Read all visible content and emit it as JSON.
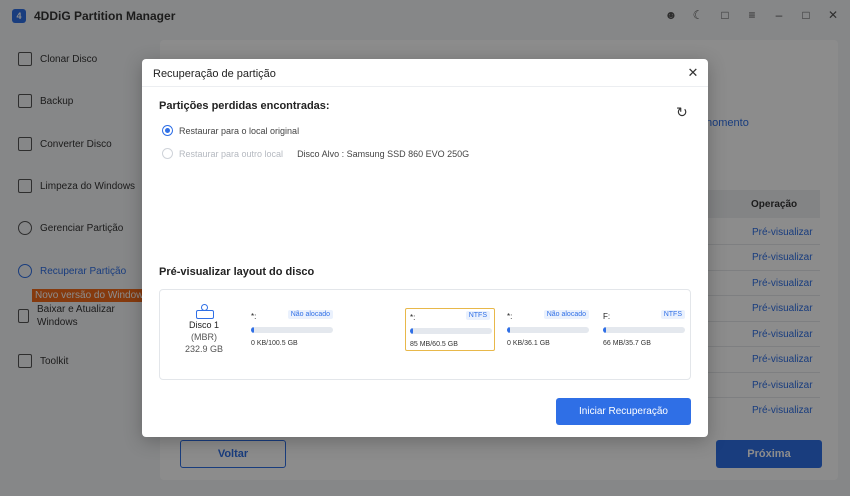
{
  "app": {
    "title": "4DDiG Partition Manager",
    "logo_letter": "4"
  },
  "window_controls": [
    "user-icon",
    "theme-icon",
    "chat-icon",
    "menu-icon",
    "minimize-icon",
    "maximize-icon",
    "close-icon"
  ],
  "sidebar": {
    "items": [
      {
        "label": "Clonar Disco",
        "icon": "clone-icon"
      },
      {
        "label": "Backup",
        "icon": "backup-icon"
      },
      {
        "label": "Converter Disco",
        "icon": "convert-icon"
      },
      {
        "label": "Limpeza do Windows",
        "icon": "clean-icon"
      },
      {
        "label": "Gerenciar Partição",
        "icon": "partition-icon"
      },
      {
        "label": "Recuperar Partição",
        "icon": "recover-icon"
      },
      {
        "label": "Baixar e Atualizar Windows",
        "icon": "download-icon"
      },
      {
        "label": "Toolkit",
        "icon": "toolkit-icon"
      }
    ],
    "badge": "Novo versão do Windows"
  },
  "background": {
    "link_fragment": "nomento",
    "column_header": "Operação",
    "preview_label": "Pré-visualizar",
    "back_button": "Voltar",
    "next_button": "Próxima"
  },
  "dialog": {
    "title": "Recuperação de partição",
    "found_title": "Partições perdidas encontradas:",
    "option_original": "Restaurar para o local original",
    "option_other": "Restaurar para outro local",
    "target_disk": "Disco Alvo : Samsung SSD 860 EVO 250G",
    "layout_title": "Pré-visualizar layout do disco",
    "disk": {
      "name": "Disco 1",
      "type": "(MBR)",
      "size": "232.9 GB"
    },
    "partitions": [
      {
        "letter": "*:",
        "tag": "Não alocado",
        "usage": "0 KB/100.5 GB",
        "fill": 0.01
      },
      {
        "letter": "*:",
        "tag": "NTFS",
        "usage": "85 MB/60.5 GB",
        "fill": 0.01
      },
      {
        "letter": "*:",
        "tag": "Não alocado",
        "usage": "0 KB/36.1 GB",
        "fill": 0.01
      },
      {
        "letter": "F:",
        "tag": "NTFS",
        "usage": "66 MB/35.7 GB",
        "fill": 0.01
      }
    ],
    "start_button": "Iniciar Recuperação"
  },
  "colors": {
    "accent": "#2f6fe6",
    "badge": "#f26a1b",
    "selected_border": "#e8b84a"
  }
}
